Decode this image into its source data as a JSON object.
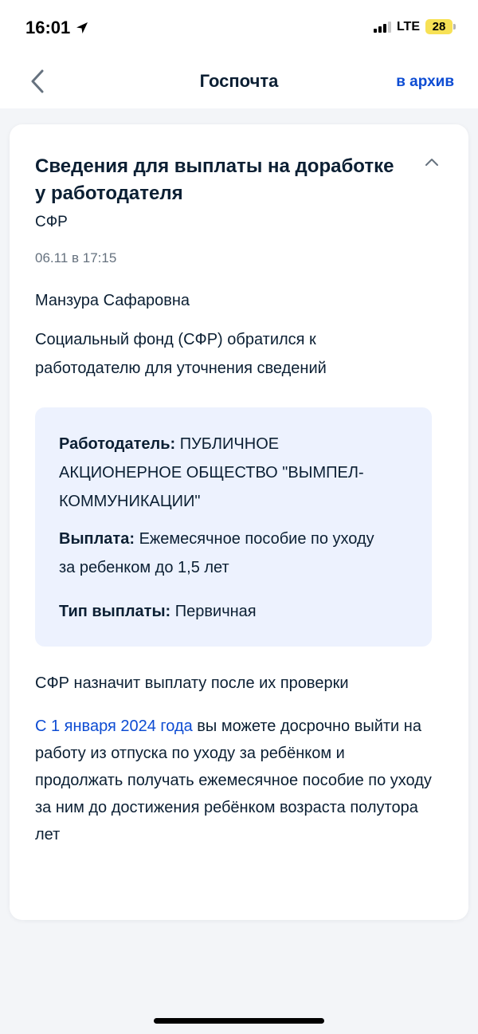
{
  "status_bar": {
    "time": "16:01",
    "network": "LTE",
    "battery": "28"
  },
  "nav": {
    "title": "Госпочта",
    "archive": "в архив"
  },
  "message": {
    "title": "Сведения для выплаты на доработке у работодателя",
    "sender": "СФР",
    "date": "06.11 в 17:15",
    "recipient": "Манзура Сафаровна",
    "intro": "Социальный фонд (СФР) обратился к работодателю для уточнения сведений",
    "details": {
      "employer_label": "Работодатель:",
      "employer_value": "ПУБЛИЧНОЕ АКЦИОНЕРНОЕ ОБЩЕСТВО \"ВЫМПЕЛ-КОММУНИКАЦИИ\"",
      "payment_label": "Выплата:",
      "payment_value": "Ежемесячное пособие по уходу за ребенком до 1,5 лет",
      "type_label": "Тип выплаты:",
      "type_value": "Первичная"
    },
    "after_check": "СФР назначит выплату после их проверки",
    "info_link": "С 1 января 2024 года",
    "info_text": " вы можете досрочно выйти на работу из отпуска по уходу за ребёнком и продолжать получать ежемесячное пособие по уходу за ним до достижения ребёнком возраста полутора лет"
  },
  "colors": {
    "accent": "#0d4cd3",
    "text": "#0b1f33",
    "muted": "#66727f",
    "info_bg": "#edf2fe",
    "page_bg": "#f3f5f8"
  },
  "icons": [
    "location-arrow-icon",
    "signal-icon",
    "battery-icon",
    "chevron-left-icon",
    "chevron-up-icon"
  ]
}
